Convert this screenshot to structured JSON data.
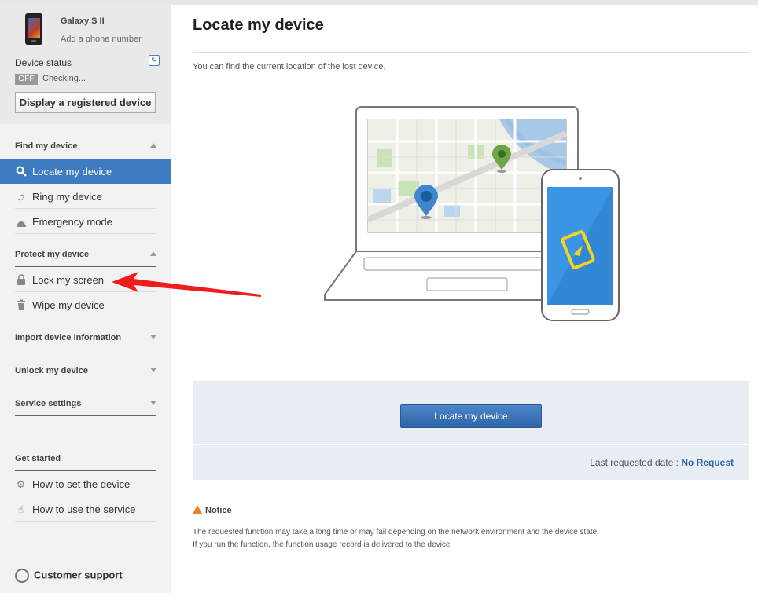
{
  "device": {
    "name": "Galaxy S II",
    "phone_link": "Add a phone number",
    "status_label": "Device status",
    "status_badge": "OFF",
    "status_text": "Checking...",
    "display_button": "Display a registered device"
  },
  "nav": {
    "find": {
      "heading": "Find my device",
      "items": [
        {
          "label": "Locate my device",
          "icon": "search-icon",
          "active": true
        },
        {
          "label": "Ring my device",
          "icon": "music-note-icon"
        },
        {
          "label": "Emergency mode",
          "icon": "emergency-icon"
        }
      ]
    },
    "protect": {
      "heading": "Protect my device",
      "items": [
        {
          "label": "Lock my screen",
          "icon": "lock-icon"
        },
        {
          "label": "Wipe my device",
          "icon": "trash-icon"
        }
      ]
    },
    "import_heading": "Import device information",
    "unlock_heading": "Unlock my device",
    "settings_heading": "Service settings",
    "get_started": {
      "heading": "Get started",
      "items": [
        {
          "label": "How to set the device",
          "icon": "gear-icon"
        },
        {
          "label": "How to use the service",
          "icon": "hand-pointer-icon"
        }
      ]
    },
    "support": "Customer support"
  },
  "main": {
    "title": "Locate my device",
    "intro": "You can find the current location of the lost device.",
    "locate_button": "Locate my device",
    "last_requested_label": "Last requested date :",
    "last_requested_value": "No Request",
    "notice_title": "Notice",
    "notice_line1": "The requested function may take a long time or may fail depending on the network environment and the device state.",
    "notice_line2": "If you run the function, the function usage record is delivered to the device."
  },
  "colors": {
    "accent": "#3e7cc2",
    "link": "#2e64a8",
    "annotation_arrow": "#ee1c1c"
  }
}
